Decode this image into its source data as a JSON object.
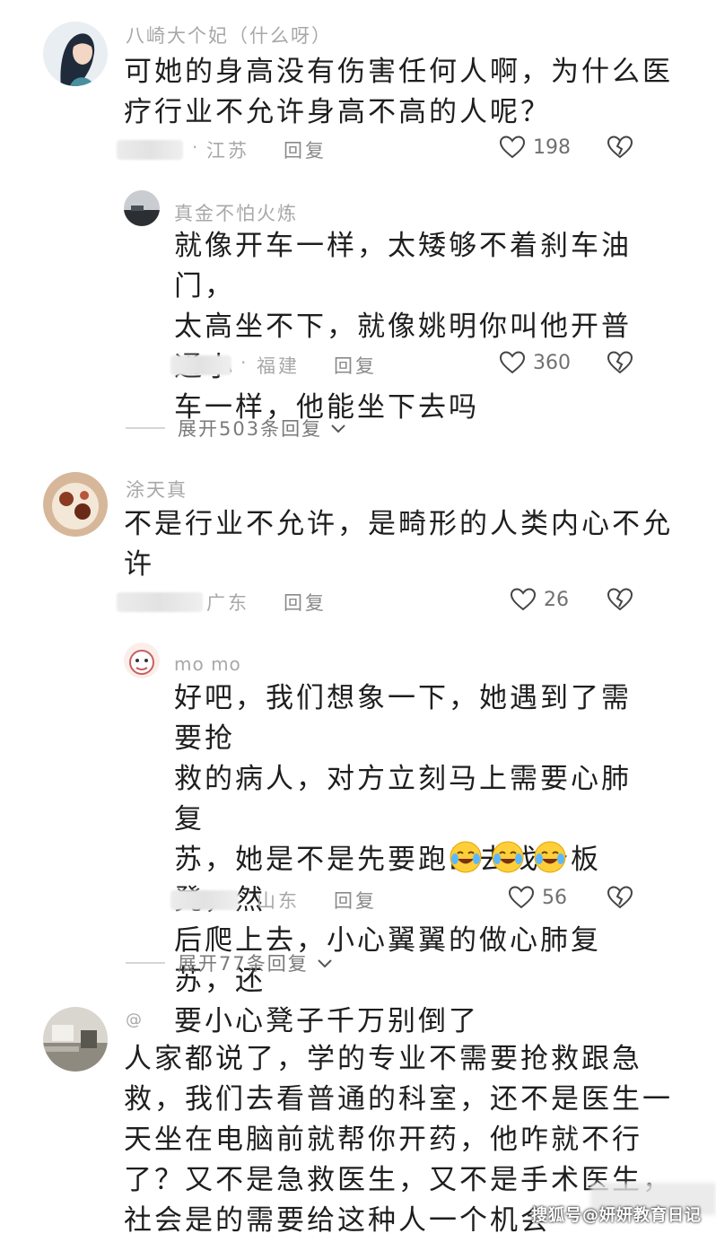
{
  "colors": {
    "text": "#1e1e1e",
    "username": "#a8a8a8",
    "meta": "#8a8a8a"
  },
  "comments": [
    {
      "username": "八崎大个妃（什么呀）",
      "content": "可她的身高没有伤害任何人啊，为什么医\n疗行业不允许身高不高的人呢？",
      "separator": "·",
      "location": "江苏",
      "reply_label": "回复",
      "likes": "198",
      "avatar_icon": "avatar-woman-icon",
      "replies": [
        {
          "username": "真金不怕火炼",
          "content": "就像开车一样，太矮够不着刹车油门，\n太高坐不下，就像姚明你叫他开普通小\n车一样，他能坐下去吗",
          "separator": "·",
          "location": "福建",
          "reply_label": "回复",
          "likes": "360"
        }
      ],
      "expand_label": "展开503条回复"
    },
    {
      "username": "涂天真",
      "content": "不是行业不允许，是畸形的人类内心不允\n许",
      "location": "广东",
      "reply_label": "回复",
      "likes": "26",
      "replies": [
        {
          "username": "mo mo",
          "content": "好吧，我们想象一下，她遇到了需要抢\n救的病人，对方立刻马上需要心肺复\n苏，她是不是先要跑出去找个板凳，然\n后爬上去，小心翼翼的做心肺复苏，还\n要小心凳子千万别倒了",
          "location": "山东",
          "reply_label": "回复",
          "likes": "56",
          "emoji_icons": [
            "laugh-cry-emoji-icon",
            "laugh-cry-emoji-icon",
            "laugh-cry-emoji-icon"
          ]
        }
      ],
      "expand_label": "展开77条回复"
    },
    {
      "username": "@",
      "content": "人家都说了，学的专业不需要抢救跟急\n救，我们去看普通的科室，还不是医生一\n天坐在电脑前就帮你开药，他咋就不行\n了？又不是急救医生，又不是手术医生，\n社会是的需要给这种人一个机会"
    }
  ],
  "watermark": "搜狐号@妍妍教育日记"
}
